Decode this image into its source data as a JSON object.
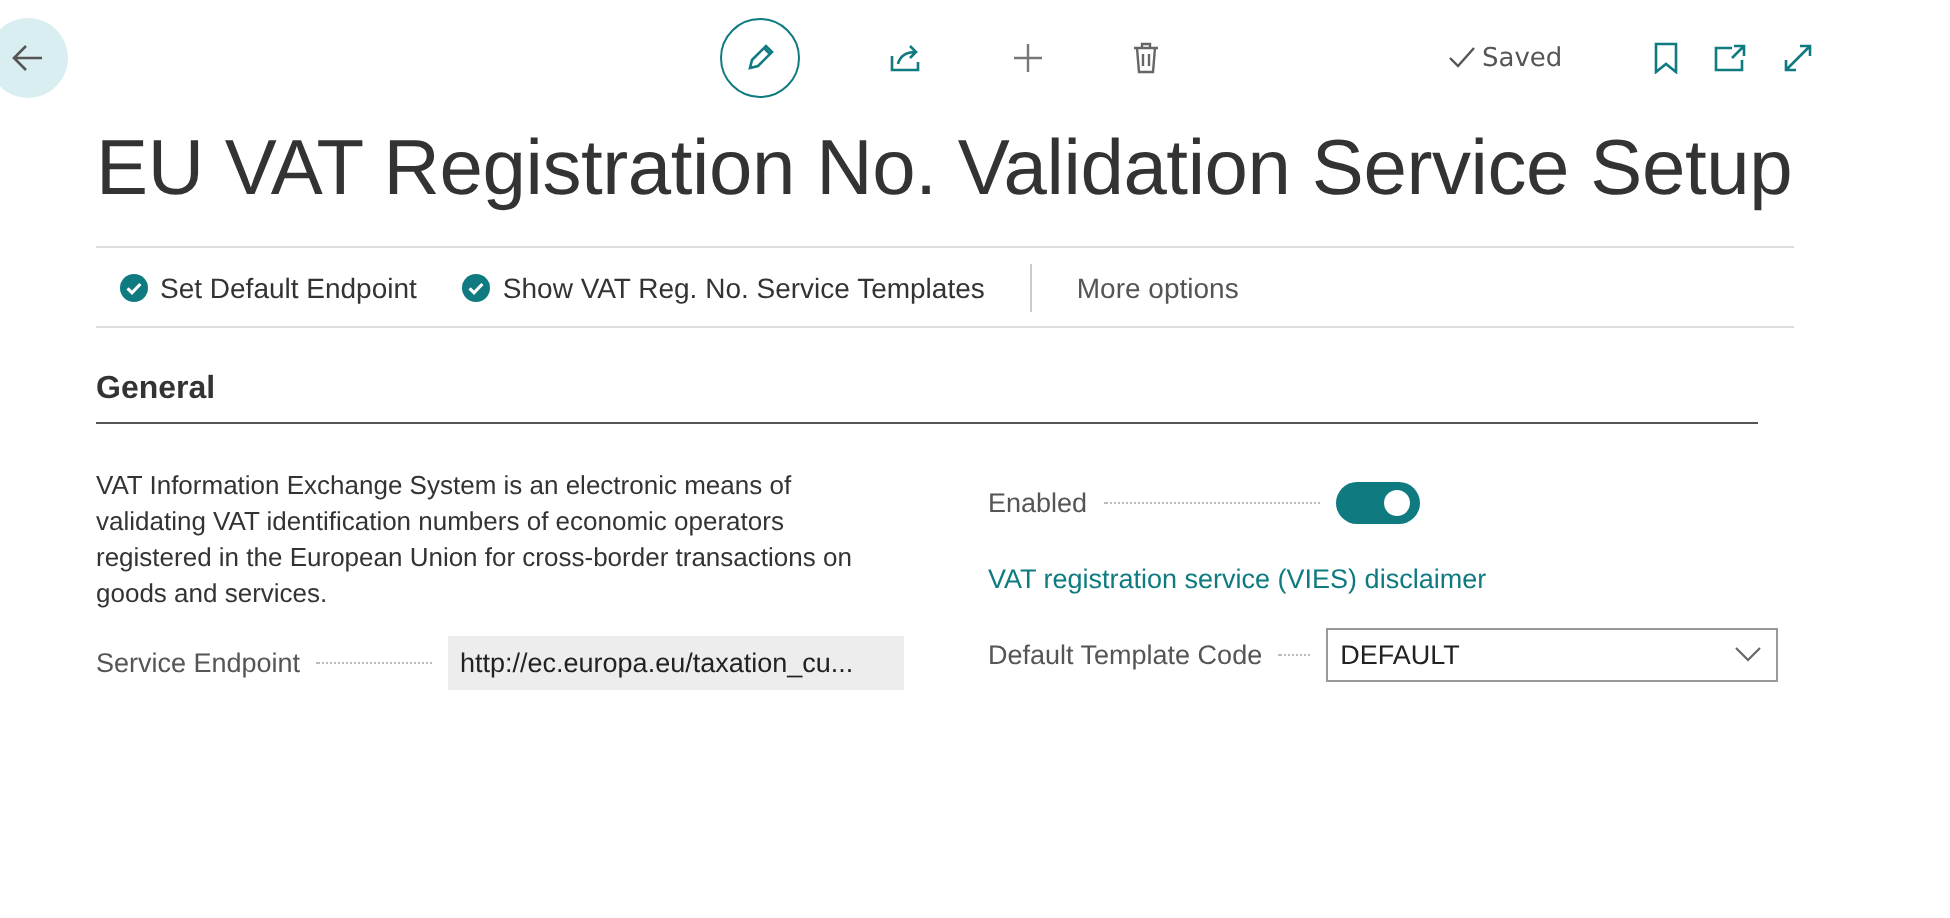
{
  "toolbar": {
    "status": "Saved"
  },
  "title": "EU VAT Registration No. Validation Service Setup",
  "actions": [
    {
      "label": "Set Default Endpoint",
      "kind": "check"
    },
    {
      "label": "Show VAT Reg. No. Service Templates",
      "kind": "check"
    },
    {
      "label": "More options",
      "kind": "more"
    }
  ],
  "section": {
    "title": "General",
    "description": "VAT Information Exchange System is an electronic means of validating VAT identification numbers of economic operators registered in the European Union for cross-border transactions on goods and services.",
    "left_fields": [
      {
        "label": "Service Endpoint",
        "kind": "readonly",
        "value": "http://ec.europa.eu/taxation_cu..."
      }
    ],
    "right_fields": [
      {
        "label": "Enabled",
        "kind": "toggle",
        "on": true
      },
      {
        "label": "VAT registration service (VIES) disclaimer",
        "kind": "link"
      },
      {
        "label": "Default Template Code",
        "kind": "select",
        "value": "DEFAULT"
      }
    ]
  }
}
